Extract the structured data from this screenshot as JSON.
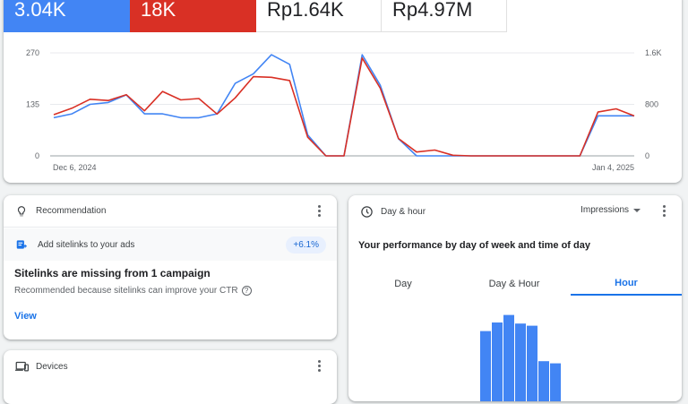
{
  "metrics": [
    {
      "value": "3.04K",
      "color": "#4285f4"
    },
    {
      "value": "18K",
      "color": "#d93025"
    },
    {
      "value": "Rp1.64K"
    },
    {
      "value": "Rp4.97M"
    }
  ],
  "chart_data": {
    "type": "line",
    "x_start_label": "Dec 6, 2024",
    "x_end_label": "Jan 4, 2025",
    "y_left_ticks": [
      "270",
      "135",
      "0"
    ],
    "y_left_range": [
      0,
      270
    ],
    "y_right_ticks": [
      "1.6K",
      "800",
      "0"
    ],
    "y_right_range": [
      0,
      1600
    ],
    "series": [
      {
        "color": "#4285f4",
        "axis": "left",
        "values": [
          100,
          110,
          135,
          140,
          160,
          110,
          110,
          100,
          100,
          110,
          190,
          215,
          265,
          240,
          55,
          0,
          0,
          265,
          185,
          45,
          0,
          0,
          0,
          0,
          0,
          0,
          0,
          0,
          0,
          0,
          105,
          105,
          105
        ]
      },
      {
        "color": "#d93025",
        "axis": "right",
        "values": [
          640,
          740,
          880,
          860,
          950,
          700,
          1000,
          870,
          890,
          650,
          900,
          1230,
          1220,
          1170,
          290,
          0,
          0,
          1520,
          1050,
          270,
          60,
          90,
          10,
          0,
          0,
          0,
          0,
          0,
          0,
          0,
          680,
          730,
          620
        ]
      }
    ]
  },
  "recommendation": {
    "title": "Recommendation",
    "item_label": "Add sitelinks to your ads",
    "badge": "+6.1%",
    "heading": "Sitelinks are missing from 1 campaign",
    "reason": "Recommended because sitelinks can improve your CTR",
    "help_icon": "?",
    "link": "View"
  },
  "devices": {
    "title": "Devices"
  },
  "day_hour": {
    "title": "Day & hour",
    "dropdown": "Impressions",
    "subtitle": "Your performance by day of week and time of day",
    "tabs": [
      {
        "label": "Day"
      },
      {
        "label": "Day & Hour"
      },
      {
        "label": "Hour",
        "active": true
      }
    ],
    "bar_color": "#4285f4",
    "bars": [
      0.72,
      0.8,
      0.87,
      0.79,
      0.77,
      0.44,
      0.42
    ]
  }
}
